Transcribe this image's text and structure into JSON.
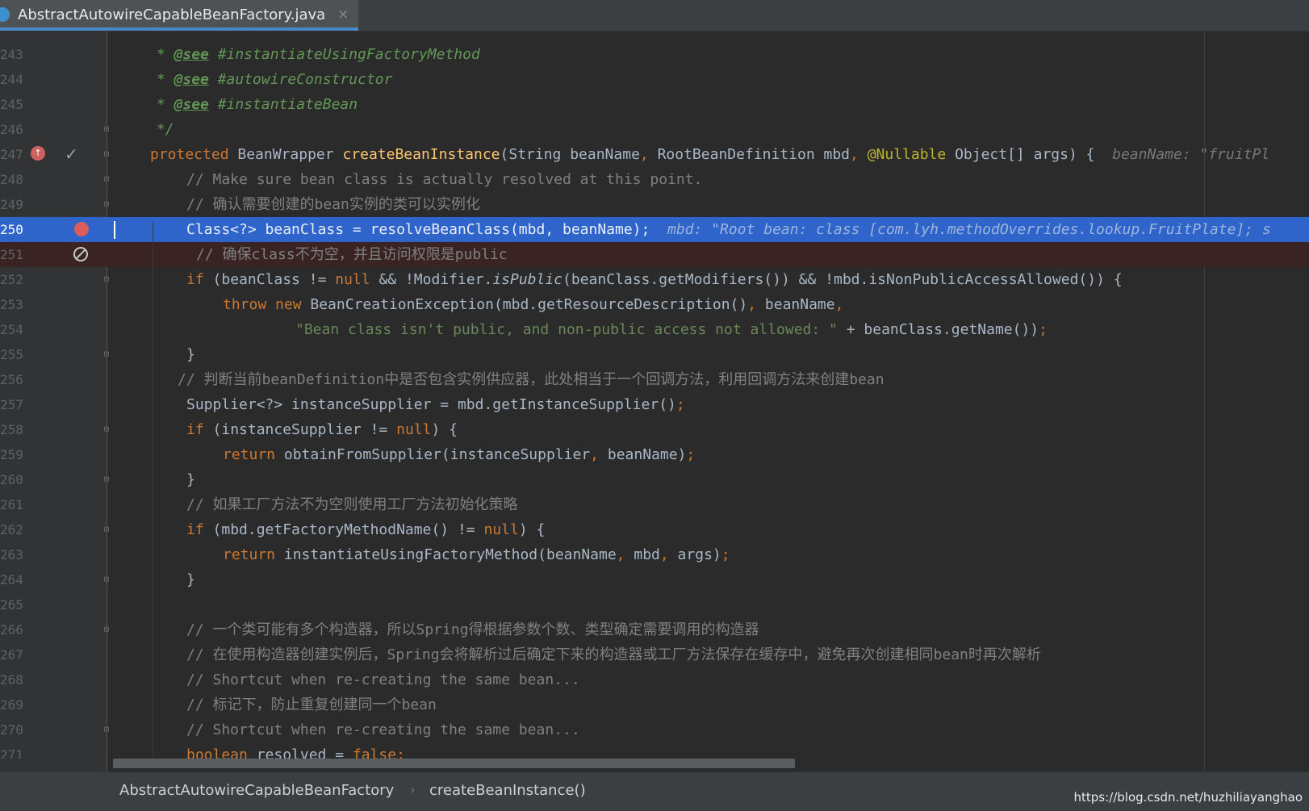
{
  "tab": {
    "file_name": "AbstractAutowireCapableBeanFactory.java",
    "close_glyph": "×"
  },
  "lines": {
    "l243": {
      "num": "243",
      "star": " * ",
      "tag": "@see",
      "ref": " #instantiateUsingFactoryMethod"
    },
    "l244": {
      "num": "244",
      "star": " * ",
      "tag": "@see",
      "ref": " #autowireConstructor"
    },
    "l245": {
      "num": "245",
      "star": " * ",
      "tag": "@see",
      "ref": " #instantiateBean"
    },
    "l246": {
      "num": "246",
      "text": " */"
    },
    "l247": {
      "num": "247",
      "kw": "protected",
      "t1": " BeanWrapper ",
      "fn": "createBeanInstance",
      "t2": "(String beanName",
      "comma1": ",",
      "t3": " RootBeanDefinition mbd",
      "comma2": ",",
      "sp": " ",
      "ann": "@Nullable",
      "t4": " Object[] args) {",
      "hint": "  beanName: \"fruitPl"
    },
    "l248": {
      "num": "248",
      "text": "// Make sure bean class is actually resolved at this point."
    },
    "l249": {
      "num": "249",
      "text": "// 确认需要创建的bean实例的类可以实例化"
    },
    "l250": {
      "num": "250",
      "code": "Class<?> beanClass = resolveBeanClass(mbd, beanName);",
      "hint": "  mbd: \"Root bean: class [com.lyh.methodOverrides.lookup.FruitPlate]; s"
    },
    "l251": {
      "num": "251",
      "text": "// 确保class不为空，并且访问权限是public"
    },
    "l252": {
      "num": "252",
      "kw": "if",
      "t1": " (beanClass != ",
      "null": "null",
      "t2": " && !Modifier.",
      "it": "isPublic",
      "t3": "(beanClass.getModifiers()) && !mbd.isNonPublicAccessAllowed()) {"
    },
    "l253": {
      "num": "253",
      "kw1": "throw",
      "sp": " ",
      "kw2": "new",
      "t1": " BeanCreationException(mbd.getResourceDescription()",
      "comma": ",",
      "t2": " beanName",
      "comma2": ","
    },
    "l254": {
      "num": "254",
      "str": "\"Bean class isn't public, and non-public access not allowed: \"",
      "t1": " + beanClass.getName())",
      "semi": ";"
    },
    "l255": {
      "num": "255",
      "text": "}"
    },
    "l256": {
      "num": "256",
      "text": "// 判断当前beanDefinition中是否包含实例供应器，此处相当于一个回调方法，利用回调方法来创建bean"
    },
    "l257": {
      "num": "257",
      "t1": "Supplier<?> instanceSupplier = mbd.getInstanceSupplier()",
      "semi": ";"
    },
    "l258": {
      "num": "258",
      "kw": "if",
      "t1": " (instanceSupplier != ",
      "null": "null",
      "t2": ") {"
    },
    "l259": {
      "num": "259",
      "kw": "return",
      "t1": " obtainFromSupplier(instanceSupplier",
      "comma": ",",
      "t2": " beanName)",
      "semi": ";"
    },
    "l260": {
      "num": "260",
      "text": "}"
    },
    "l261": {
      "num": "261",
      "text": "// 如果工厂方法不为空则使用工厂方法初始化策略"
    },
    "l262": {
      "num": "262",
      "kw": "if",
      "t1": " (mbd.getFactoryMethodName() != ",
      "null": "null",
      "t2": ") {"
    },
    "l263": {
      "num": "263",
      "kw": "return",
      "t1": " instantiateUsingFactoryMethod(beanName",
      "comma": ",",
      "t2": " mbd",
      "comma2": ",",
      "t3": " args)",
      "semi": ";"
    },
    "l264": {
      "num": "264",
      "text": "}"
    },
    "l265": {
      "num": "265",
      "text": ""
    },
    "l266": {
      "num": "266",
      "text": "// 一个类可能有多个构造器，所以Spring得根据参数个数、类型确定需要调用的构造器"
    },
    "l267": {
      "num": "267",
      "text": "// 在使用构造器创建实例后，Spring会将解析过后确定下来的构造器或工厂方法保存在缓存中，避免再次创建相同bean时再次解析"
    },
    "l268": {
      "num": "268",
      "text": "// Shortcut when re-creating the same bean..."
    },
    "l269": {
      "num": "269",
      "text": "// 标记下，防止重复创建同一个bean"
    },
    "l270": {
      "num": "270",
      "text": "// Shortcut when re-creating the same bean..."
    },
    "l271": {
      "num": "271",
      "kw": "boolean",
      "t1": " resolved = ",
      "kw2": "false",
      "semi": ";"
    }
  },
  "breadcrumb": {
    "class_name": "AbstractAutowireCapableBeanFactory",
    "separator": "›",
    "method": "createBeanInstance()"
  },
  "watermark": "https://blog.csdn.net/huzhiliayanghao",
  "colors": {
    "current_line": "#2f65ca",
    "breakpoint_line": "#3a2323",
    "keyword": "#cc7832",
    "comment": "#808080",
    "doc": "#629755",
    "string": "#6a8759",
    "function": "#ffc66d",
    "annotation": "#bbb529"
  }
}
